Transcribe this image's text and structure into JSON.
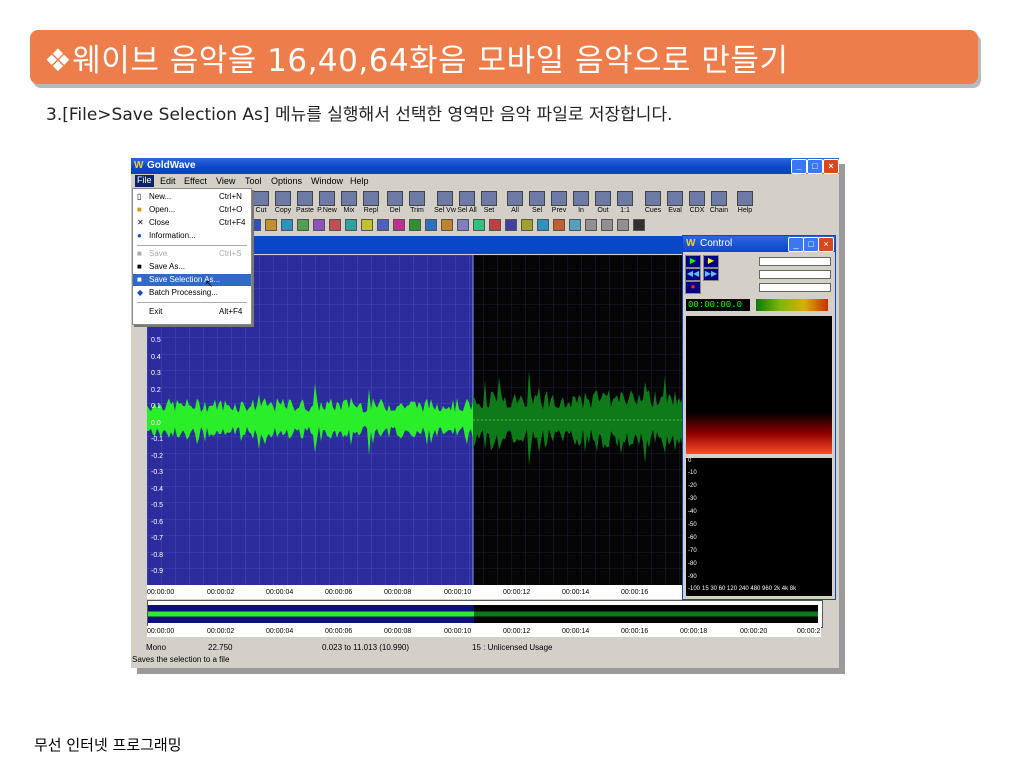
{
  "slide": {
    "title": "❖웨이브 음악을 16,40,64화음 모바일 음악으로 만들기",
    "step": "3.[File>Save Selection As] 메뉴를 실행해서 선택한 영역만 음악 파일로 저장합니다.",
    "footer": "무선 인터넷 프로그래밍"
  },
  "app": {
    "title": "GoldWave",
    "menus": [
      "File",
      "Edit",
      "Effect",
      "View",
      "Tool",
      "Options",
      "Window",
      "Help"
    ],
    "toolbar": [
      "Cut",
      "Copy",
      "Paste",
      "P.New",
      "Mix",
      "Repl",
      "Del",
      "Trim",
      "Sel Vw",
      "Sel All",
      "Set",
      "All",
      "Sel",
      "Prev",
      "In",
      "Out",
      "1:1",
      "Cues",
      "Eval",
      "CDX",
      "Chain",
      "Help"
    ],
    "file_menu": [
      {
        "label": "New...",
        "shortcut": "Ctrl+N",
        "icon": "new-file-icon",
        "state": "normal"
      },
      {
        "label": "Open...",
        "shortcut": "Ctrl+O",
        "icon": "open-folder-icon",
        "state": "normal"
      },
      {
        "label": "Close",
        "shortcut": "Ctrl+F4",
        "icon": "close-x-icon",
        "state": "normal"
      },
      {
        "label": "Information...",
        "shortcut": "",
        "icon": "info-icon",
        "state": "normal"
      },
      {
        "label": "Save",
        "shortcut": "Ctrl+S",
        "icon": "save-icon",
        "state": "disabled"
      },
      {
        "label": "Save As...",
        "shortcut": "",
        "icon": "save-as-icon",
        "state": "normal"
      },
      {
        "label": "Save Selection As...",
        "shortcut": "",
        "icon": "save-selection-icon",
        "state": "highlighted"
      },
      {
        "label": "Batch Processing...",
        "shortcut": "",
        "icon": "batch-icon",
        "state": "normal"
      },
      {
        "label": "Exit",
        "shortcut": "Alt+F4",
        "icon": "",
        "state": "normal"
      }
    ],
    "y_axis": [
      "0.5",
      "0.4",
      "0.3",
      "0.2",
      "0.1",
      "0.0",
      "-0.1",
      "-0.2",
      "-0.3",
      "-0.4",
      "-0.5",
      "-0.6",
      "-0.7",
      "-0.8",
      "-0.9"
    ],
    "timeline": [
      "00:00:00",
      "00:00:02",
      "00:00:04",
      "00:00:06",
      "00:00:08",
      "00:00:10",
      "00:00:12",
      "00:00:14",
      "00:00:16"
    ],
    "overview_timeline": [
      "00:00:00",
      "00:00:02",
      "00:00:04",
      "00:00:06",
      "00:00:08",
      "00:00:10",
      "00:00:12",
      "00:00:14",
      "00:00:16",
      "00:00:18",
      "00:00:20",
      "00:00:2"
    ],
    "control": {
      "title": "Control",
      "time": "00:00:00.0",
      "spectrum_y": [
        "0",
        "-10",
        "-20",
        "-30",
        "-40",
        "-50",
        "-60",
        "-70",
        "-80",
        "-90",
        "-100"
      ],
      "spectrum_x": "15 30 60 120 240 480 960 2k 4k 8k"
    },
    "status": {
      "channel": "Mono",
      "length": "22.750",
      "selection": "0.023 to 11.013 (10.990)",
      "license": "15 : Unlicensed Usage",
      "hint": "Saves the selection to a file"
    },
    "colors": {
      "wave_bg": "#2c2c9c",
      "wave_selected": "#22ee22",
      "wave_unselected": "#0e7a1a",
      "title_bar": "#0a46c8",
      "banner": "#ed7d4b"
    }
  }
}
